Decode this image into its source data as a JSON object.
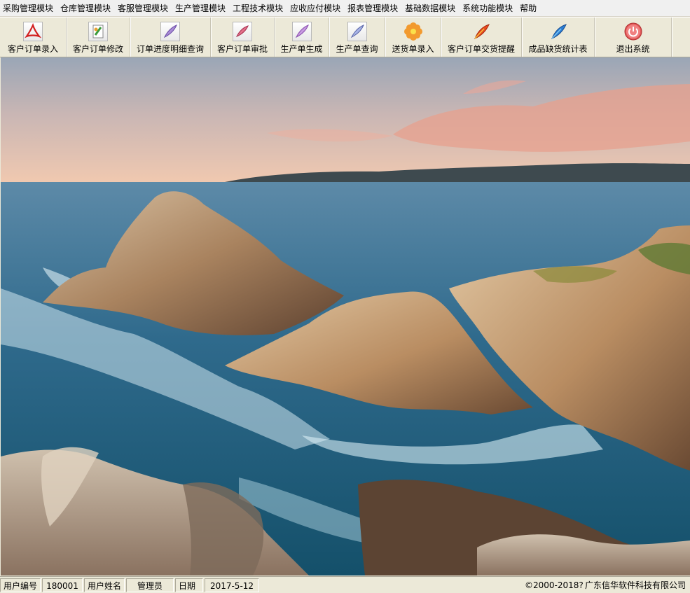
{
  "menu": {
    "items": [
      "采购管理模块",
      "仓库管理模块",
      "客服管理模块",
      "生产管理模块",
      "工程技术模块",
      "应收应付模块",
      "报表管理模块",
      "基础数据模块",
      "系统功能模块",
      "帮助"
    ]
  },
  "toolbar": {
    "buttons": [
      {
        "label": "客户订单录入",
        "icon": "pdf-icon"
      },
      {
        "label": "客户订单修改",
        "icon": "document-edit-icon"
      },
      {
        "label": "订单进度明细查询",
        "icon": "feather-document-icon"
      },
      {
        "label": "客户订单审批",
        "icon": "approve-document-icon"
      },
      {
        "label": "生产单生成",
        "icon": "feather-document-icon"
      },
      {
        "label": "生产单查询",
        "icon": "feather-document-icon"
      },
      {
        "label": "送货单录入",
        "icon": "flower-icon"
      },
      {
        "label": "客户订单交货提醒",
        "icon": "feather-icon"
      },
      {
        "label": "成品缺货统计表",
        "icon": "blue-feather-icon"
      },
      {
        "label": "退出系统",
        "icon": "power-icon"
      }
    ]
  },
  "status": {
    "user_id_label": "用户编号",
    "user_id": "180001",
    "user_name_label": "用户姓名",
    "user_name": "管理员",
    "date_label": "日期",
    "date": "2017-5-12",
    "copyright": "©2000-2018?",
    "company": "广东信华软件科技有限公司"
  },
  "colors": {
    "window_bg": "#ece9d8",
    "sky_top": "#9aa7b6",
    "sky_bottom": "#f1c7b0",
    "sea": "#1f5d7d",
    "rock": "#b08a66"
  }
}
